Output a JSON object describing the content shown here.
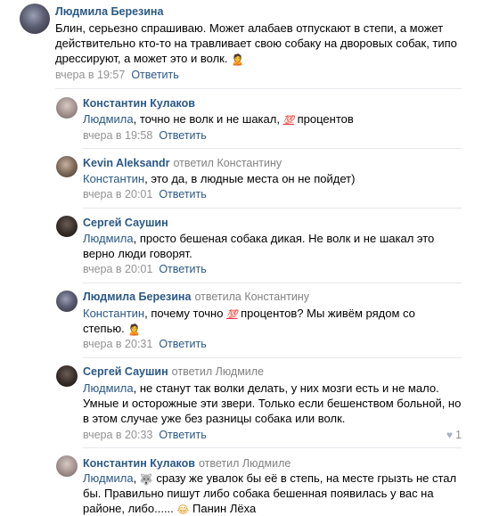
{
  "comments": [
    {
      "author": "Людмила Березина",
      "reply_prefix": "",
      "reply_to": "",
      "lines": [
        [
          "Блин, серьезно спрашиваю. Может алабаев отпускают в степи, а может"
        ],
        [
          "действительно кто-то на травливает свою собаку на дворовых собак, типо"
        ],
        [
          "дрессируют, а может это и волк. "
        ]
      ],
      "emoji_trailing": "🙎",
      "time": "вчера в 19:57",
      "reply_label": "Ответить"
    },
    {
      "author": "Константин Кулаков",
      "reply_prefix": "",
      "reply_to": "",
      "mention": "Людмила",
      "text_after_mention": ", точно не волк и не шакал, ",
      "emoji_mid": "💯",
      "text_end": " процентов",
      "time": "вчера в 19:58",
      "reply_label": "Ответить"
    },
    {
      "author": "Kevin Aleksandr",
      "reply_prefix": "ответил",
      "reply_to": "Константину",
      "mention": "Константин",
      "text_after_mention": ", это да, в людные места он не пойдет)",
      "time": "вчера в 20:01",
      "reply_label": "Ответить"
    },
    {
      "author": "Сергей Саушин",
      "reply_prefix": "",
      "reply_to": "",
      "mention": "Людмила",
      "line1_after_mention": ", просто бешеная собака дикая. Не волк и не шакал это",
      "line2": "верно люди говорят.",
      "time": "вчера в 20:01",
      "reply_label": "Ответить"
    },
    {
      "author": "Людмила Березина",
      "reply_prefix": "ответила",
      "reply_to": "Константину",
      "mention": "Константин",
      "line1_a": ", почему точно ",
      "emoji_mid": "💯",
      "line1_b": " процентов? Мы живём рядом со",
      "line2": "степью. ",
      "emoji_trailing": "🙎",
      "time": "вчера в 20:31",
      "reply_label": "Ответить"
    },
    {
      "author": "Сергей Саушин",
      "reply_prefix": "ответил",
      "reply_to": "Людмиле",
      "mention": "Людмила",
      "line1_after_mention": ", не станут так волки делать, у них мозги есть и не мало.",
      "line2": "Умные и осторожные эти звери. Только если бешенством больной, но",
      "line3": "в этом случае уже без разницы собака или волк.",
      "time": "вчера в 20:33",
      "reply_label": "Ответить",
      "likes": "1"
    },
    {
      "author": "Константин Кулаков",
      "reply_prefix": "ответил",
      "reply_to": "Людмиле",
      "mention": "Людмила",
      "line1_a": ", ",
      "emoji_mid": "🐺",
      "line1_b": " сразу же увалок бы её в степь, на месте грызть не стал",
      "line2": "бы. Правильно пишут либо собака бешенная появилась у вас на",
      "line3_a": "районе, либо...... ",
      "emoji_line3": "😂",
      "line3_b": " Панин Лёха"
    }
  ]
}
